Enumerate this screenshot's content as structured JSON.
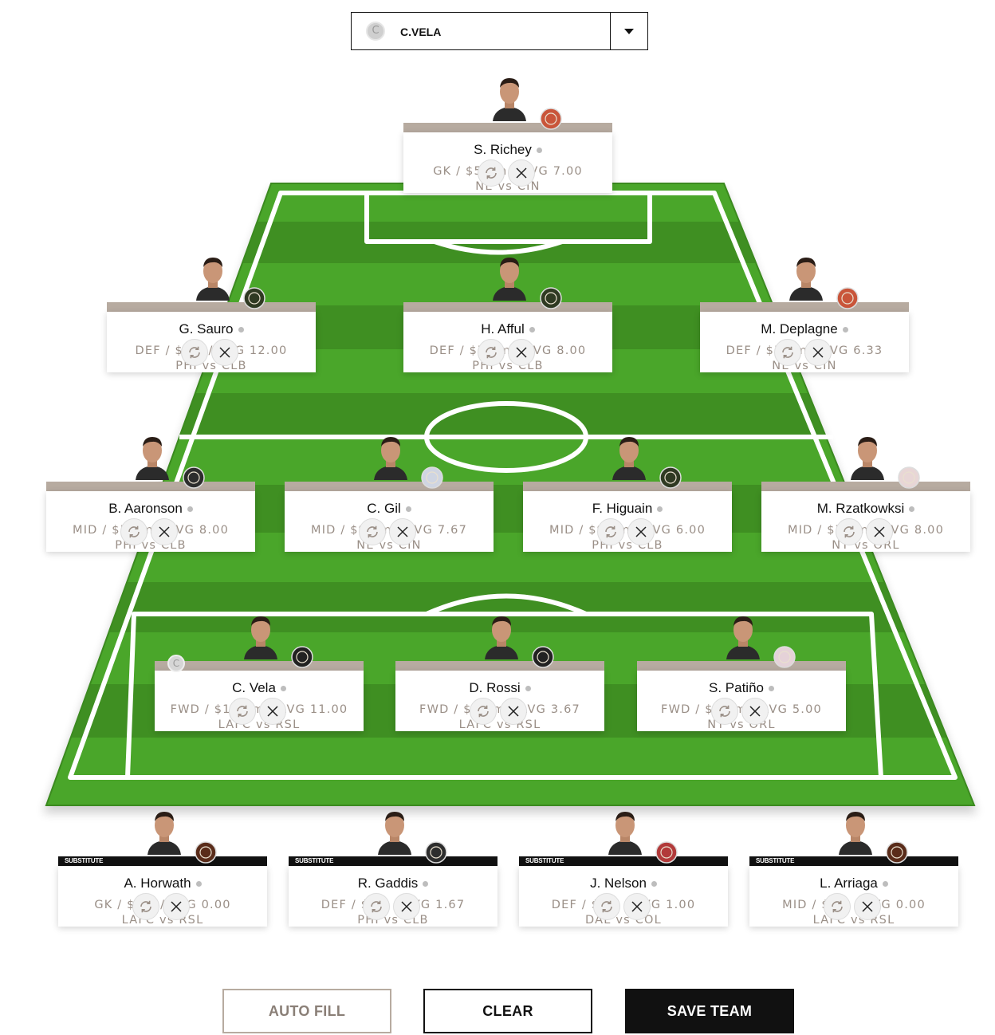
{
  "captain_select": {
    "label": "C.VELA",
    "badge": "C"
  },
  "substitute_label": "SUBSTITUTE",
  "captain_mark": "C",
  "starters": [
    {
      "name": "S. Richey",
      "info": "GK / $5.3m / AVG 7.00",
      "match": "NE vs CIN",
      "club_color": "#c9553a"
    },
    {
      "name": "G. Sauro",
      "info": "DEF / $6m / AVG 12.00",
      "match": "PHI vs CLB",
      "club_color": "#2f3a22"
    },
    {
      "name": "H. Afful",
      "info": "DEF / $7.7m / AVG 8.00",
      "match": "PHI vs CLB",
      "club_color": "#2f3a22"
    },
    {
      "name": "M. Deplagne",
      "info": "DEF / $5.8m / AVG 6.33",
      "match": "NE vs CIN",
      "club_color": "#c9553a"
    },
    {
      "name": "B. Aaronson",
      "info": "MID / $5.5m / AVG 8.00",
      "match": "PHI vs CLB",
      "club_color": "#2d2d2d"
    },
    {
      "name": "C. Gil",
      "info": "MID / $9.7m / AVG 7.67",
      "match": "NE vs CIN",
      "club_color": "#cfd5e2"
    },
    {
      "name": "F. Higuain",
      "info": "MID / $9.4m / AVG 6.00",
      "match": "PHI vs CLB",
      "club_color": "#2f3a22"
    },
    {
      "name": "M. Rzatkowksi",
      "info": "MID / $7.5m / AVG 8.00",
      "match": "NY vs ORL",
      "club_color": "#e8d6d6"
    },
    {
      "name": "C. Vela",
      "info": "FWD / $11.8m / AVG 11.00",
      "match": "LAFC vs RSL",
      "club_color": "#222222"
    },
    {
      "name": "D. Rossi",
      "info": "FWD / $9.1m / AVG 3.67",
      "match": "LAFC vs RSL",
      "club_color": "#222222"
    },
    {
      "name": "S. Patiño",
      "info": "FWD / $5.3m / AVG 5.00",
      "match": "NY vs ORL",
      "club_color": "#e5d2d8"
    }
  ],
  "substitutes": [
    {
      "name": "A. Horwath",
      "info": "GK / $4m / AVG 0.00",
      "match": "LAFC vs RSL",
      "club_color": "#5a2c1a"
    },
    {
      "name": "R. Gaddis",
      "info": "DEF / $4m / AVG 1.67",
      "match": "PHI vs CLB",
      "club_color": "#2d2d2d"
    },
    {
      "name": "J. Nelson",
      "info": "DEF / $4m / AVG 1.00",
      "match": "DAL vs COL",
      "club_color": "#b23a3a"
    },
    {
      "name": "L. Arriaga",
      "info": "MID / $4m / AVG 0.00",
      "match": "LAFC vs RSL",
      "club_color": "#5a2c1a"
    }
  ],
  "actions": {
    "auto_fill": "AUTO FILL",
    "clear": "CLEAR",
    "save_team": "SAVE TEAM"
  },
  "colors": {
    "pitch_dark": "#3f8f22",
    "pitch_light": "#4aa62a",
    "accent": "#b7aba0",
    "dark": "#111111"
  }
}
